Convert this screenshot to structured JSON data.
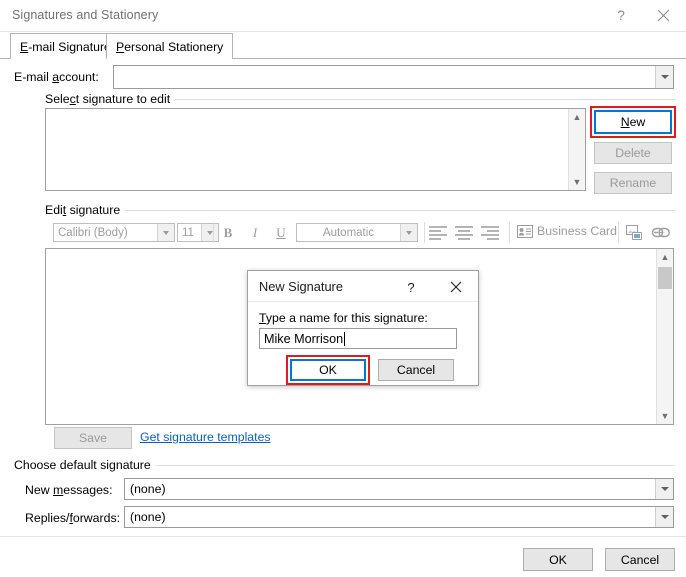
{
  "window": {
    "title": "Signatures and Stationery",
    "help_icon": "?",
    "close_icon": "close-icon"
  },
  "tabs": [
    {
      "label": "E-mail Signature",
      "accel": "E",
      "selected": true
    },
    {
      "label": "Personal Stationery",
      "accel": "P",
      "selected": false
    }
  ],
  "email_account": {
    "label": "E-mail account:",
    "accel": "a",
    "value": ""
  },
  "select_signature": {
    "group_label": "Select signature to edit",
    "accel": "c",
    "items": [],
    "buttons": {
      "new": {
        "label": "New",
        "accel": "N",
        "enabled": true,
        "focused": true,
        "highlighted": true
      },
      "delete": {
        "label": "Delete",
        "enabled": false
      },
      "rename": {
        "label": "Rename",
        "enabled": false
      }
    }
  },
  "edit_signature": {
    "group_label": "Edit signature",
    "accel": "t",
    "toolbar": {
      "font_family": "Calibri (Body)",
      "font_size": "11",
      "bold": "B",
      "italic": "I",
      "underline": "U",
      "font_color": "Automatic",
      "align_left": "align-left-icon",
      "align_center": "align-center-icon",
      "align_right": "align-right-icon",
      "business_card": "Business Card",
      "insert_picture": "insert-picture-icon",
      "insert_hyperlink": "insert-hyperlink-icon"
    },
    "content": "",
    "save_button": {
      "label": "Save",
      "enabled": false
    },
    "templates_link": "Get signature templates"
  },
  "default_signature": {
    "group_label": "Choose default signature",
    "new_messages": {
      "label": "New messages:",
      "accel": "m",
      "value": "(none)"
    },
    "replies_forwards": {
      "label": "Replies/forwards:",
      "accel": "f",
      "value": "(none)"
    }
  },
  "footer": {
    "ok": "OK",
    "cancel": "Cancel"
  },
  "modal": {
    "title": "New Signature",
    "help_icon": "?",
    "close_icon": "close-icon",
    "prompt": "Type a name for this signature:",
    "prompt_accel": "T",
    "input_value": "Mike Morrison",
    "ok": {
      "label": "OK",
      "focused": true,
      "highlighted": true
    },
    "cancel": {
      "label": "Cancel"
    }
  },
  "colors": {
    "accent_focus": "#0078d7",
    "annotation": "#e01b1b",
    "link": "#0563c1",
    "disabled_text": "#9a9a9a",
    "title_text": "#707070"
  }
}
